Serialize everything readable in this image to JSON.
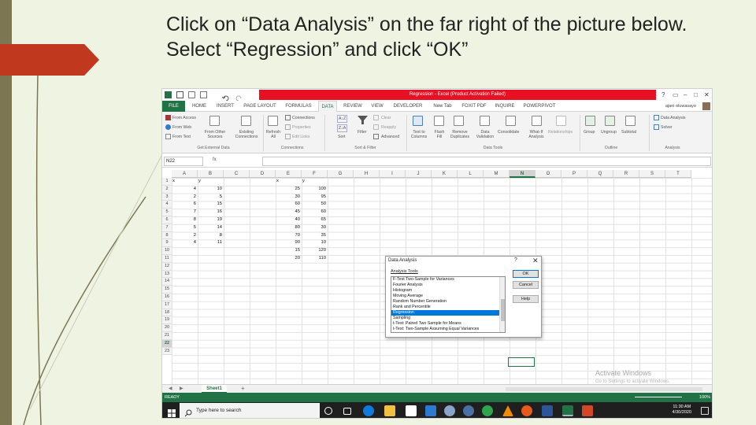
{
  "slide": {
    "title": "Click on “Data Analysis” on the far right of the picture below. Select “Regression” and click “OK”"
  },
  "excel": {
    "window_title": "Regression - Excel (Product Activation Failed)",
    "user_name": "ajani oluwasayo",
    "tabs": [
      "FILE",
      "HOME",
      "INSERT",
      "PAGE LAYOUT",
      "FORMULAS",
      "DATA",
      "REVIEW",
      "VIEW",
      "DEVELOPER",
      "New Tab",
      "FOXIT PDF",
      "INQUIRE",
      "POWERPIVOT"
    ],
    "active_tab": "DATA",
    "ribbon": {
      "get_external": {
        "items": [
          "From Access",
          "From Web",
          "From Text",
          "From Other Sources",
          "Existing Connections"
        ],
        "label": "Get External Data"
      },
      "refresh_all": "Refresh All",
      "connections": {
        "items": [
          "Connections",
          "Properties",
          "Edit Links"
        ],
        "label": "Connections"
      },
      "sort_filter": {
        "sort_az": "A↓Z",
        "sort_za": "Z↓A",
        "sort": "Sort",
        "filter": "Filter",
        "clear": "Clear",
        "reapply": "Reapply",
        "advanced": "Advanced",
        "label": "Sort & Filter"
      },
      "data_tools": {
        "items": [
          "Text to Columns",
          "Flash Fill",
          "Remove Duplicates",
          "Data Validation",
          "Consolidate",
          "What-If Analysis",
          "Relationships"
        ],
        "label": "Data Tools"
      },
      "outline": {
        "items": [
          "Group",
          "Ungroup",
          "Subtotal"
        ],
        "label": "Outline"
      },
      "analysis": {
        "items": [
          "Data Analysis",
          "Solver"
        ],
        "label": "Analysis"
      }
    },
    "name_box": "N22",
    "fx": "fx",
    "columns": [
      "A",
      "B",
      "C",
      "D",
      "E",
      "F",
      "G",
      "H",
      "I",
      "J",
      "K",
      "L",
      "M",
      "N",
      "O",
      "P",
      "Q",
      "R",
      "S",
      "T"
    ],
    "selected_column": "N",
    "rows": [
      "1",
      "2",
      "3",
      "4",
      "5",
      "6",
      "7",
      "8",
      "9",
      "10",
      "11",
      "12",
      "13",
      "14",
      "15",
      "16",
      "17",
      "18",
      "19",
      "20",
      "21",
      "22",
      "23"
    ],
    "selected_row": "22",
    "table1": {
      "hx": "x",
      "hy": "y",
      "x": [
        "4",
        "2",
        "6",
        "7",
        "8",
        "5",
        "2",
        "4"
      ],
      "y": [
        "10",
        "5",
        "15",
        "16",
        "19",
        "14",
        "8",
        "11"
      ]
    },
    "table2": {
      "hx": "x",
      "hy": "y",
      "x": [
        "25",
        "30",
        "60",
        "45",
        "40",
        "80",
        "70",
        "90",
        "15",
        "20"
      ],
      "y": [
        "100",
        "95",
        "50",
        "60",
        "65",
        "30",
        "35",
        "10",
        "120",
        "110"
      ]
    },
    "dialog": {
      "title": "Data Analysis",
      "help_glyph": "?",
      "close_glyph": "✕",
      "subtitle": "Analysis Tools",
      "tools": [
        "F-Test Two-Sample for Variances",
        "Fourier Analysis",
        "Histogram",
        "Moving Average",
        "Random Number Generation",
        "Rank and Percentile",
        "Regression",
        "Sampling",
        "t-Test: Paired Two Sample for Means",
        "t-Test: Two-Sample Assuming Equal Variances"
      ],
      "selected_tool": "Regression",
      "ok": "OK",
      "cancel": "Cancel",
      "help": "Help"
    },
    "watermark": {
      "line1": "Activate Windows",
      "line2": "Go to Settings to activate Windows."
    },
    "sheet_tab": "Sheet1",
    "add_sheet": "+",
    "status": {
      "ready": "READY",
      "zoom": "100%"
    },
    "taskbar": {
      "search_placeholder": "Type here to search",
      "time": "11:30 AM",
      "date": "4/30/2020"
    },
    "colors": {
      "excel_green": "#217346",
      "title_red": "#e81123",
      "selection_blue": "#0078d7"
    }
  }
}
